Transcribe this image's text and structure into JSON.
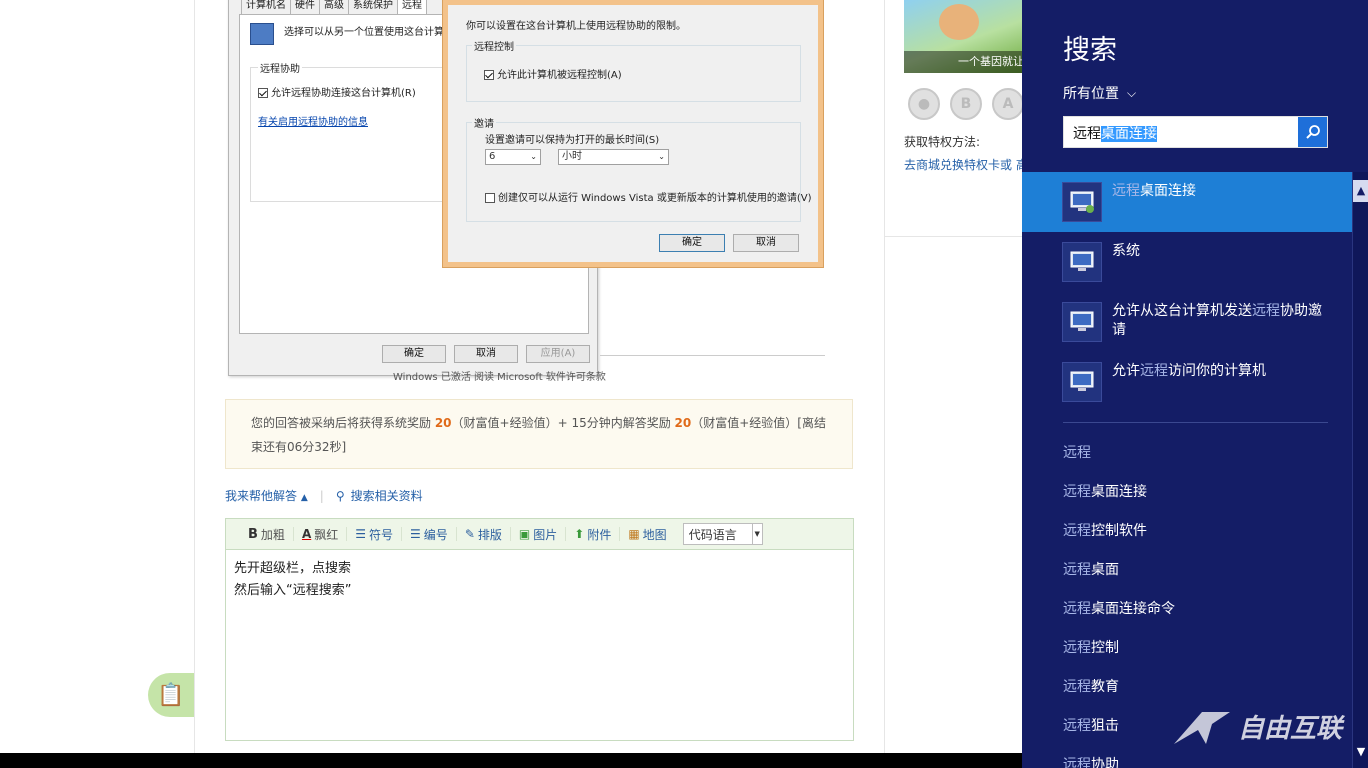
{
  "screenshot": {
    "bg_window": {
      "tabs": [
        "计算机名",
        "硬件",
        "高级",
        "系统保护",
        "远程"
      ],
      "desc": "选择可以从另一个位置使用这台计算机的",
      "group_label": "远程协助",
      "checkbox_label": "允许远程协助连接这台计算机(R)",
      "link": "有关启用远程协助的信息",
      "btn_ok": "确定",
      "btn_cancel": "取消",
      "btn_apply": "应用(A)",
      "caption": "Windows 已激活  阅读 Microsoft 软件许可条款"
    },
    "fg_window": {
      "intro": "你可以设置在这台计算机上使用远程协助的限制。",
      "group1": "远程控制",
      "chk1": "允许此计算机被远程控制(A)",
      "group2": "邀请",
      "time_label": "设置邀请可以保持为打开的最长时间(S)",
      "time_value": "6",
      "time_unit": "小时",
      "chk2": "创建仅可以从运行 Windows Vista 或更新版本的计算机使用的邀请(V)",
      "btn_ok": "确定",
      "btn_cancel": "取消"
    }
  },
  "reward": {
    "t1": "您的回答被采纳后将获得系统奖励 ",
    "n1": "20",
    "t2": "（财富值+经验值）+ 15分钟内解答奖励 ",
    "n2": "20",
    "t3": "（财富值+经验值）[离结束还有06分32秒]"
  },
  "help": {
    "answer": "我来帮他解答",
    "search": "搜索相关资料"
  },
  "toolbar": {
    "bold": "加粗",
    "red": "飘红",
    "symbol": "符号",
    "number": "编号",
    "layout": "排版",
    "image": "图片",
    "attach": "附件",
    "map": "地图",
    "code": "代码语言"
  },
  "editor": {
    "line1": "先开超级栏，点搜索",
    "line2": "然后输入“远程搜索”"
  },
  "right": {
    "banner_caption": "一个基因就让",
    "privilege_label": "获取特权方法:",
    "privilege_link": "去商城兑换特权卡或 高"
  },
  "charm": {
    "title": "搜索",
    "scope": "所有位置",
    "query_plain": "远程",
    "query_selected": "桌面连接",
    "results": [
      {
        "pre": "",
        "hl": "远程",
        "post": "桌面连接"
      },
      {
        "pre": "",
        "hl": "",
        "post": "系统"
      },
      {
        "pre": "允许从这台计算机发送",
        "hl": "远程",
        "post": "协助邀请"
      },
      {
        "pre": "允许",
        "hl": "远程",
        "post": "访问你的计算机"
      }
    ],
    "suggestions": [
      {
        "a": "远程",
        "b": ""
      },
      {
        "a": "远程",
        "b": "桌面连接"
      },
      {
        "a": "远程",
        "b": "控制软件"
      },
      {
        "a": "远程",
        "b": "桌面"
      },
      {
        "a": "远程",
        "b": "桌面连接命令"
      },
      {
        "a": "远程",
        "b": "控制"
      },
      {
        "a": "远程",
        "b": "教育"
      },
      {
        "a": "远程",
        "b": "狙击"
      },
      {
        "a": "远程",
        "b": "协助"
      }
    ],
    "watermark": "自由互联"
  }
}
